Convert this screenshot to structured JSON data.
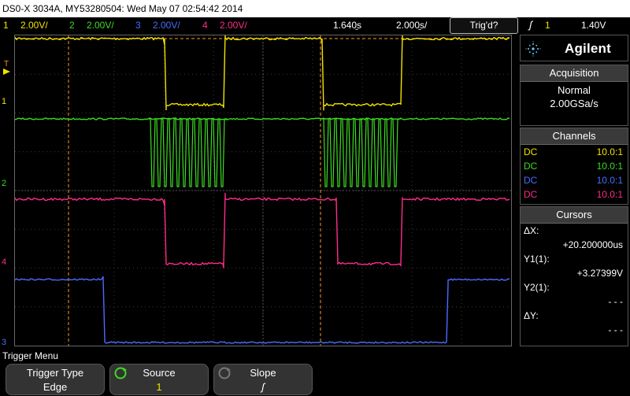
{
  "header": {
    "title": "DS0-X 3034A, MY53280504: Wed May 07 02:54:42 2014"
  },
  "status": {
    "ch1": {
      "num": "1",
      "scale": "2.00V/"
    },
    "ch2": {
      "num": "2",
      "scale": "2.00V/"
    },
    "ch3": {
      "num": "3",
      "scale": "2.00V/"
    },
    "ch4": {
      "num": "4",
      "scale": "2.00V/"
    },
    "delay": "1.640̱s",
    "timebase": "2.000̱s/",
    "trigger_state": "Trig'd?",
    "trigger_slope_glyph": "ʃ",
    "trigger_source": "1",
    "trigger_level": "1.40V"
  },
  "markers": {
    "trigger": "T",
    "ch1": "1",
    "ch2": "2",
    "ch3": "3",
    "ch4": "4"
  },
  "side": {
    "brand": "Agilent",
    "acquisition": {
      "title": "Acquisition",
      "mode": "Normal",
      "rate": "2.00GSa/s"
    },
    "channels": {
      "title": "Channels",
      "rows": [
        {
          "coupling": "DC",
          "probe": "10.0:1",
          "color": "#f2e300"
        },
        {
          "coupling": "DC",
          "probe": "10.0:1",
          "color": "#3cdc22"
        },
        {
          "coupling": "DC",
          "probe": "10.0:1",
          "color": "#4a6cff"
        },
        {
          "coupling": "DC",
          "probe": "10.0:1",
          "color": "#ff2c8a"
        }
      ]
    },
    "cursors": {
      "title": "Cursors",
      "dx_label": "ΔX:",
      "dx_value": "+20.200000us",
      "y1_label": "Y1(1):",
      "y1_value": "+3.27399V",
      "y2_label": "Y2(1):",
      "y2_value": "- - -",
      "dy_label": "ΔY:",
      "dy_value": "- - -"
    }
  },
  "menu": {
    "title": "Trigger Menu",
    "keys": [
      {
        "label": "Trigger Type",
        "value": "Edge"
      },
      {
        "label": "Source",
        "value": "1"
      },
      {
        "label": "Slope",
        "value": "ʃ"
      }
    ]
  },
  "colors": {
    "ch1": "#f2e300",
    "ch2": "#3cdc22",
    "ch3": "#4a6cff",
    "ch4": "#ff2c8a",
    "trigger": "#ff9a1a"
  }
}
